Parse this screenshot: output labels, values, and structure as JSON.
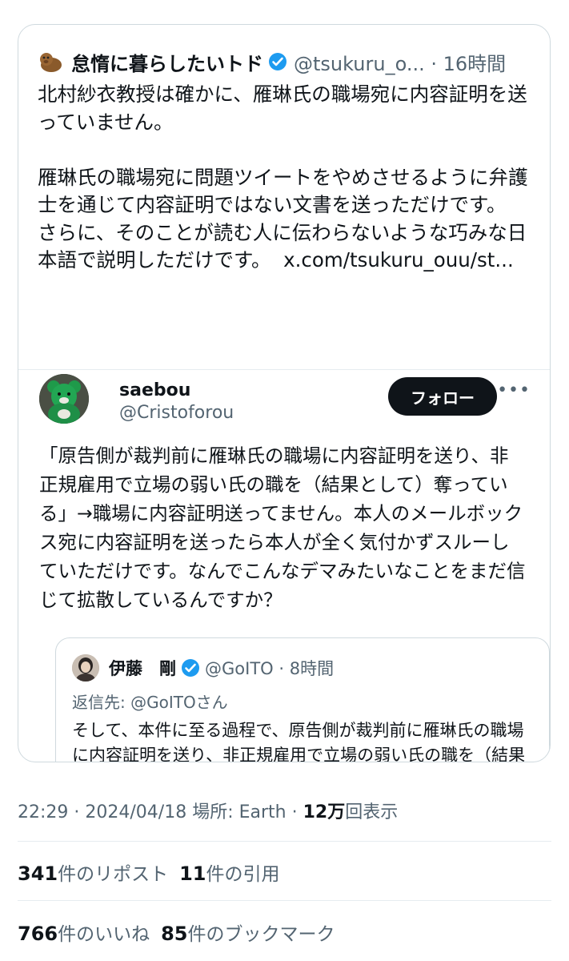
{
  "quote_tweet": {
    "name": "怠惰に暮らしたいトド",
    "handle": "@tsukuru_o...",
    "time": "16時間",
    "text": "北村紗衣教授は確かに、雁琳氏の職場宛に内容証明を送っていません。\n\n雁琳氏の職場宛に問題ツイートをやめさせるように弁護士を通じて内容証明ではない文書を送っただけです。\nさらに、そのことが読む人に伝わらないような巧みな日本語で説明しただけです。",
    "link": "x.com/tsukuru_ouu/st..."
  },
  "inner_tweet": {
    "name": "saebou",
    "handle": "@Cristoforou",
    "follow_label": "フォロー",
    "more_label": "•••",
    "text": "「原告側が裁判前に雁琳氏の職場に内容証明を送り、非正規雇用で立場の弱い氏の職を（結果として）奪っている」→職場に内容証明送ってません。本人のメールボックス宛に内容証明を送ったら本人が全く気付かずスルーしていただけです。なんでこんなデマみたいなことをまだ信じて拡散しているんですか？"
  },
  "nested_tweet": {
    "name": "伊藤　剛",
    "handle": "@GoITO",
    "time": "8時間",
    "reply_to": "返信先: @GoITOさん",
    "text": "そして、本件に至る過程で、原告側が裁判前に雁琳氏の職場に内容証明を送り、非正規雇用で立場の弱い氏の職を（結果として）奪っているという経緯がある。これを踏ま"
  },
  "meta": {
    "time": "22:29",
    "date": "2024/04/18",
    "location": "場所: Earth",
    "views_num": "12万",
    "views_label": "回表示"
  },
  "stats": {
    "reposts_num": "341",
    "reposts_label": "件のリポスト",
    "quotes_num": "11",
    "quotes_label": "件の引用",
    "likes_num": "766",
    "likes_label": "件のいいね",
    "bookmarks_num": "85",
    "bookmarks_label": "件のブックマーク"
  },
  "colors": {
    "verified": "#1d9bf0",
    "text": "#0f1419",
    "muted": "#536471",
    "border": "#cfd9de"
  }
}
